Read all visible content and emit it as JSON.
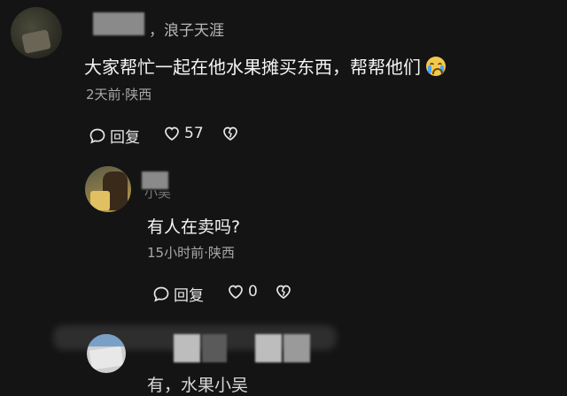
{
  "comments": [
    {
      "author_suffix": "，浪子天涯",
      "text": "大家帮忙一起在他水果摊买东西，帮帮他们",
      "emoji": "crying-face-icon",
      "meta": "2天前·陕西",
      "reply_label": "回复",
      "like_count": "57"
    },
    {
      "author_partial": "小吴",
      "text": "有人在卖吗?",
      "meta": "15小时前·陕西",
      "reply_label": "回复",
      "like_count": "0"
    },
    {
      "text": "有，水果小吴"
    }
  ],
  "colors": {
    "background": "#141414",
    "text": "#f4f4f4",
    "meta": "#a8a8a8"
  }
}
